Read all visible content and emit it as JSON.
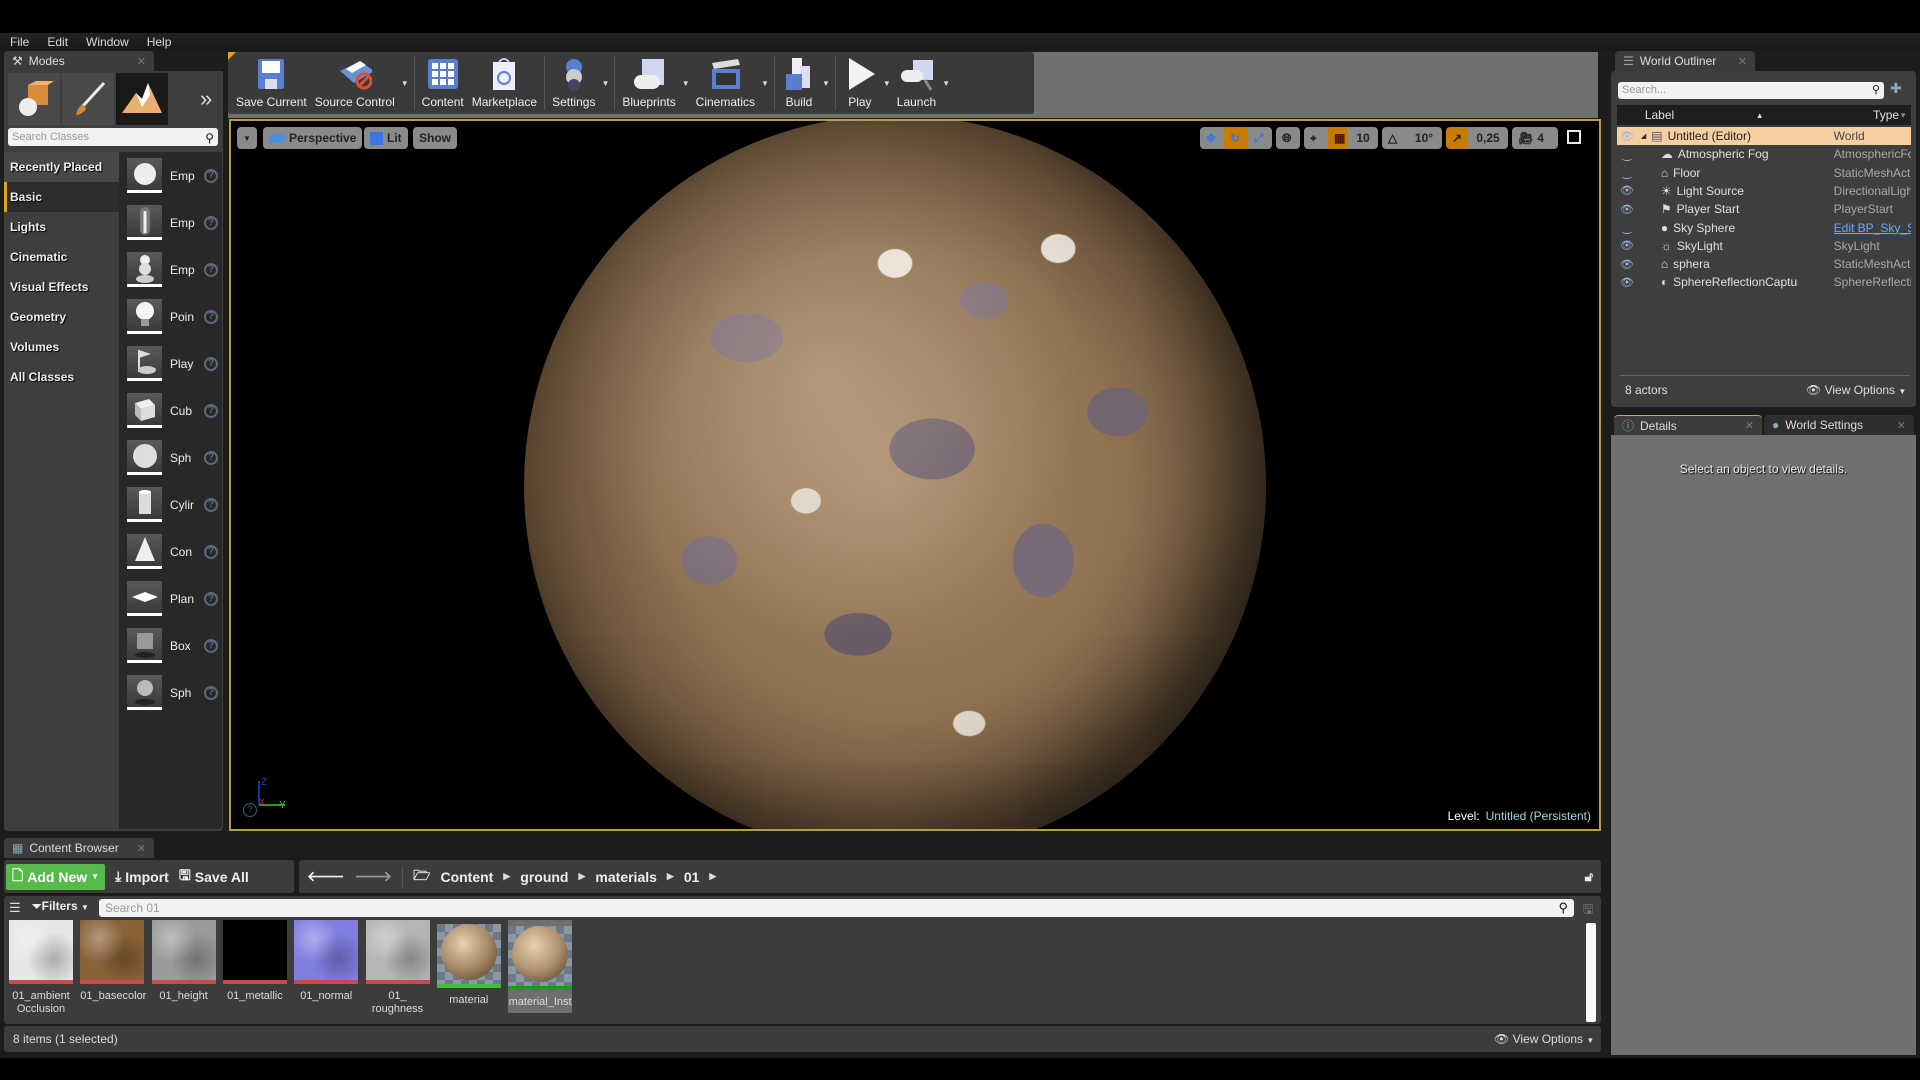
{
  "menu": [
    "File",
    "Edit",
    "Window",
    "Help"
  ],
  "modes": {
    "tab_label": "Modes",
    "mode_buttons": [
      {
        "name": "place-mode",
        "icon": "place-mode-icon"
      },
      {
        "name": "paint-mode",
        "icon": "paint-brush-icon"
      },
      {
        "name": "landscape-mode",
        "icon": "landscape-icon",
        "active": true
      }
    ],
    "search_placeholder": "Search Classes",
    "categories": [
      "Recently Placed",
      "Basic",
      "Lights",
      "Cinematic",
      "Visual Effects",
      "Geometry",
      "Volumes",
      "All Classes"
    ],
    "selected_category": "Basic",
    "items": [
      "Emp",
      "Emp",
      "Emp",
      "Poin",
      "Play",
      "Cub",
      "Sph",
      "Cylir",
      "Con",
      "Plan",
      "Box",
      "Sph"
    ]
  },
  "toolbar": {
    "buttons": [
      {
        "label": "Save Current",
        "icon": "save-icon",
        "dropdown": false
      },
      {
        "label": "Source Control",
        "icon": "source-control-icon",
        "dropdown": true
      },
      {
        "label": "Content",
        "icon": "content-icon",
        "dropdown": false
      },
      {
        "label": "Marketplace",
        "icon": "marketplace-icon",
        "dropdown": false
      },
      {
        "label": "Settings",
        "icon": "settings-icon",
        "dropdown": true
      },
      {
        "label": "Blueprints",
        "icon": "blueprints-icon",
        "dropdown": true
      },
      {
        "label": "Cinematics",
        "icon": "cinematics-icon",
        "dropdown": true
      },
      {
        "label": "Build",
        "icon": "build-icon",
        "dropdown": true
      },
      {
        "label": "Play",
        "icon": "play-icon",
        "dropdown": true
      },
      {
        "label": "Launch",
        "icon": "launch-icon",
        "dropdown": true
      }
    ]
  },
  "viewport": {
    "view_mode": "Perspective",
    "lighting": "Lit",
    "show": "Show",
    "grid_snap": "10",
    "rotation_snap": "10°",
    "scale_snap": "0,25",
    "camera_speed": "4",
    "level_label": "Level:",
    "level_name": "Untitled (Persistent)",
    "axes": [
      "Z",
      "X",
      "Y"
    ]
  },
  "outliner": {
    "tab_label": "World Outliner",
    "search_placeholder": "Search...",
    "col_label": "Label",
    "col_type": "Type",
    "rows": [
      {
        "label": "Untitled (Editor)",
        "type": "World",
        "visible": true,
        "selected": true,
        "icon": "world-icon"
      },
      {
        "label": "Atmospheric Fog",
        "type": "AtmosphericFc",
        "visible": false,
        "icon": "fog-icon"
      },
      {
        "label": "Floor",
        "type": "StaticMeshAct",
        "visible": false,
        "icon": "static-mesh-icon"
      },
      {
        "label": "Light Source",
        "type": "DirectionalLigh",
        "visible": true,
        "icon": "directional-light-icon"
      },
      {
        "label": "Player Start",
        "type": "PlayerStart",
        "visible": true,
        "icon": "player-start-icon"
      },
      {
        "label": "Sky Sphere",
        "type": "Edit BP_Sky_S",
        "visible": false,
        "link": true,
        "icon": "sky-sphere-icon"
      },
      {
        "label": "SkyLight",
        "type": "SkyLight",
        "visible": true,
        "icon": "skylight-icon"
      },
      {
        "label": "sphera",
        "type": "StaticMeshAct",
        "visible": true,
        "icon": "static-mesh-icon"
      },
      {
        "label": "SphereReflectionCapture",
        "type": "SphereReflecti",
        "visible": true,
        "icon": "reflection-capture-icon"
      }
    ],
    "actor_count": "8 actors",
    "view_options": "View Options"
  },
  "details": {
    "tab_label": "Details",
    "world_settings_tab": "World Settings",
    "empty_message": "Select an object to view details."
  },
  "content_browser": {
    "tab_label": "Content Browser",
    "add_new": "Add New",
    "import": "Import",
    "save_all": "Save All",
    "path": [
      "Content",
      "ground",
      "materials",
      "01"
    ],
    "filters": "Filters",
    "search_placeholder": "Search 01",
    "assets": [
      {
        "name": "01_ambient Occlusion",
        "kind": "texture",
        "swatch": "#e6e6e6"
      },
      {
        "name": "01_basecolor",
        "kind": "texture",
        "swatch": "#8a6238"
      },
      {
        "name": "01_height",
        "kind": "texture",
        "swatch": "#9a9a9a"
      },
      {
        "name": "01_metallic",
        "kind": "texture",
        "swatch": "#000000"
      },
      {
        "name": "01_normal",
        "kind": "texture",
        "swatch": "#7f7fe0"
      },
      {
        "name": "01_ roughness",
        "kind": "texture",
        "swatch": "#b5b5b5"
      },
      {
        "name": "material",
        "kind": "material",
        "swatch": "#a88a66"
      },
      {
        "name": "material_Inst",
        "kind": "material_instance",
        "swatch": "#b09272",
        "selected": true
      }
    ],
    "item_count": "8 items (1 selected)",
    "view_options": "View Options"
  },
  "colors": {
    "accent": "#e0a526",
    "selection": "#f5cfa2",
    "add_new": "#57b94a",
    "level_name": "#9ad6e6"
  }
}
